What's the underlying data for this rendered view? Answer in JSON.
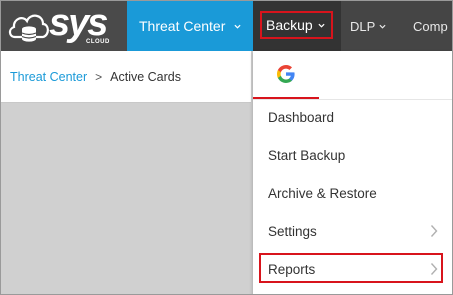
{
  "logo": {
    "text": "sys",
    "subtext": "CLOUD"
  },
  "nav": {
    "threat_center": "Threat Center",
    "backup": "Backup",
    "dlp": "DLP",
    "comp": "Comp"
  },
  "breadcrumb": {
    "link": "Threat Center",
    "separator": ">",
    "current": "Active Cards"
  },
  "dropdown": {
    "tab_icon": "google-icon",
    "items": [
      {
        "label": "Dashboard",
        "has_arrow": false
      },
      {
        "label": "Start Backup",
        "has_arrow": false
      },
      {
        "label": "Archive & Restore",
        "has_arrow": false
      },
      {
        "label": "Settings",
        "has_arrow": true
      },
      {
        "label": "Reports",
        "has_arrow": true
      }
    ]
  },
  "colors": {
    "accent_blue": "#1a9ad8",
    "highlight_red": "#d8141c",
    "nav_dark": "#454545"
  }
}
